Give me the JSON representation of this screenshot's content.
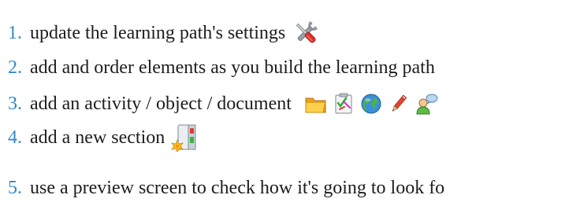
{
  "steps": [
    {
      "number": "1.",
      "text": "update the learning path's settings",
      "icons": [
        "tools-icon"
      ]
    },
    {
      "number": "2.",
      "text": "add and order elements as you build the learning path",
      "icons": []
    },
    {
      "number": "3.",
      "text": "add an activity / object / document",
      "icons": [
        "folder-icon",
        "checklist-icon",
        "globe-icon",
        "pencil-icon",
        "user-chat-icon"
      ]
    },
    {
      "number": "4.",
      "text": "add a new section",
      "icons": [
        "new-section-icon"
      ]
    },
    {
      "number": "5.",
      "text": "use a preview screen to check how it's going to look fo",
      "icons": []
    }
  ],
  "colors": {
    "number": "#3388c8",
    "text": "#1d1d1d"
  }
}
